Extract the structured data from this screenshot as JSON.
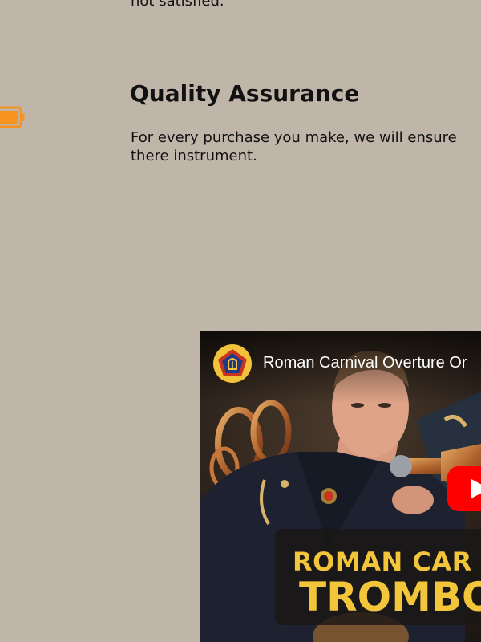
{
  "previous_section": {
    "cut_text": "not satisfied."
  },
  "quality_assurance": {
    "icon": "battery-icon",
    "icon_color": "#f7931e",
    "title": "Quality Assurance",
    "body": "For every purchase you make, we will ensure there instrument."
  },
  "video": {
    "title": "Roman Carnival Overture Or",
    "banner_line1": "ROMAN CAR",
    "banner_line2": "TROMBO",
    "banner_color": "#f3c53a",
    "play_button_color": "#ff0000",
    "channel_logo_icon": "lyre-pentagon-icon"
  }
}
